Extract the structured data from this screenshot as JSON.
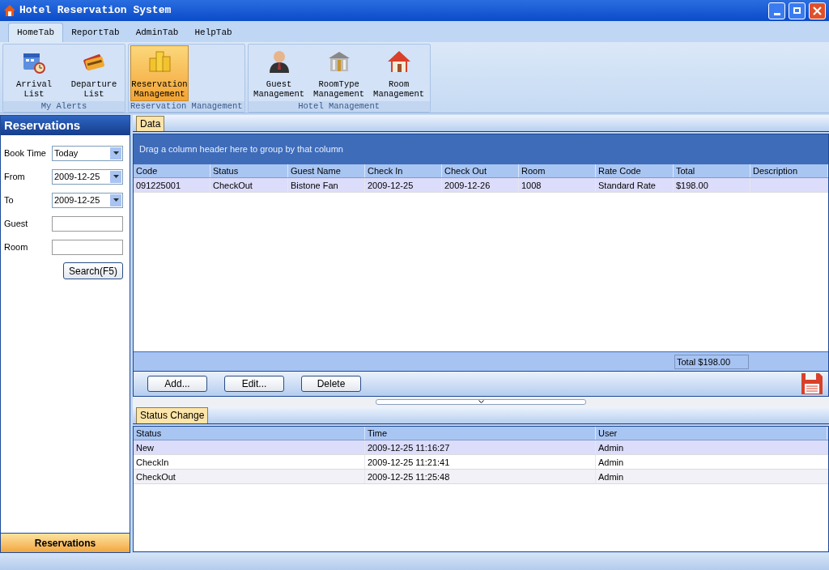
{
  "window": {
    "title": "Hotel Reservation System"
  },
  "tabs": [
    {
      "label": "HomeTab",
      "selected": true
    },
    {
      "label": "ReportTab",
      "selected": false
    },
    {
      "label": "AdminTab",
      "selected": false
    },
    {
      "label": "HelpTab",
      "selected": false
    }
  ],
  "ribbon_groups": [
    {
      "label": "My Alerts",
      "items": [
        {
          "label": "Arrival List",
          "kind": "calendar",
          "selected": false
        },
        {
          "label": "Departure List",
          "kind": "cards",
          "selected": false
        }
      ]
    },
    {
      "label": "Reservation Management",
      "items": [
        {
          "label": "Reservation Management",
          "kind": "coins",
          "selected": true
        }
      ]
    },
    {
      "label": "Hotel Management",
      "items": [
        {
          "label": "Guest Management",
          "kind": "person",
          "selected": false
        },
        {
          "label": "RoomType Management",
          "kind": "building",
          "selected": false
        },
        {
          "label": "Room Management",
          "kind": "house",
          "selected": false
        }
      ]
    }
  ],
  "sidebar": {
    "title": "Reservations",
    "fields": [
      {
        "label": "Book Time",
        "kind": "dropdown",
        "value": "Today"
      },
      {
        "label": "From",
        "kind": "dropdown",
        "value": "2009-12-25"
      },
      {
        "label": "To",
        "kind": "dropdown",
        "value": "2009-12-25"
      },
      {
        "label": "Guest",
        "kind": "text"
      },
      {
        "label": "Room",
        "kind": "text"
      }
    ],
    "search_button": "Search(F5)",
    "footer_button": "Reservations"
  },
  "data_panel": {
    "tab": "Data",
    "group_hint": "Drag a column header here to group by that column",
    "columns": [
      "Code",
      "Status",
      "Guest Name",
      "Check In",
      "Check Out",
      "Room",
      "Rate Code",
      "Total",
      "Description"
    ],
    "rows": [
      {
        "selected": true,
        "cells": [
          "091225001",
          "CheckOut",
          "Bistone Fan",
          "2009-12-25",
          "2009-12-26",
          "1008",
          "Standard Rate",
          "$198.00",
          ""
        ]
      }
    ],
    "summary": "Total $198.00",
    "buttons": [
      "Add...",
      "Edit...",
      "Delete"
    ]
  },
  "status_panel": {
    "tab": "Status Change",
    "columns": [
      "Status",
      "Time",
      "User"
    ],
    "rows": [
      {
        "selected": true,
        "cells": [
          "New",
          "2009-12-25 11:16:27",
          "Admin"
        ]
      },
      {
        "selected": false,
        "cells": [
          "CheckIn",
          "2009-12-25 11:21:41",
          "Admin"
        ]
      },
      {
        "selected": false,
        "cells": [
          "CheckOut",
          "2009-12-25 11:25:48",
          "Admin"
        ]
      }
    ]
  }
}
